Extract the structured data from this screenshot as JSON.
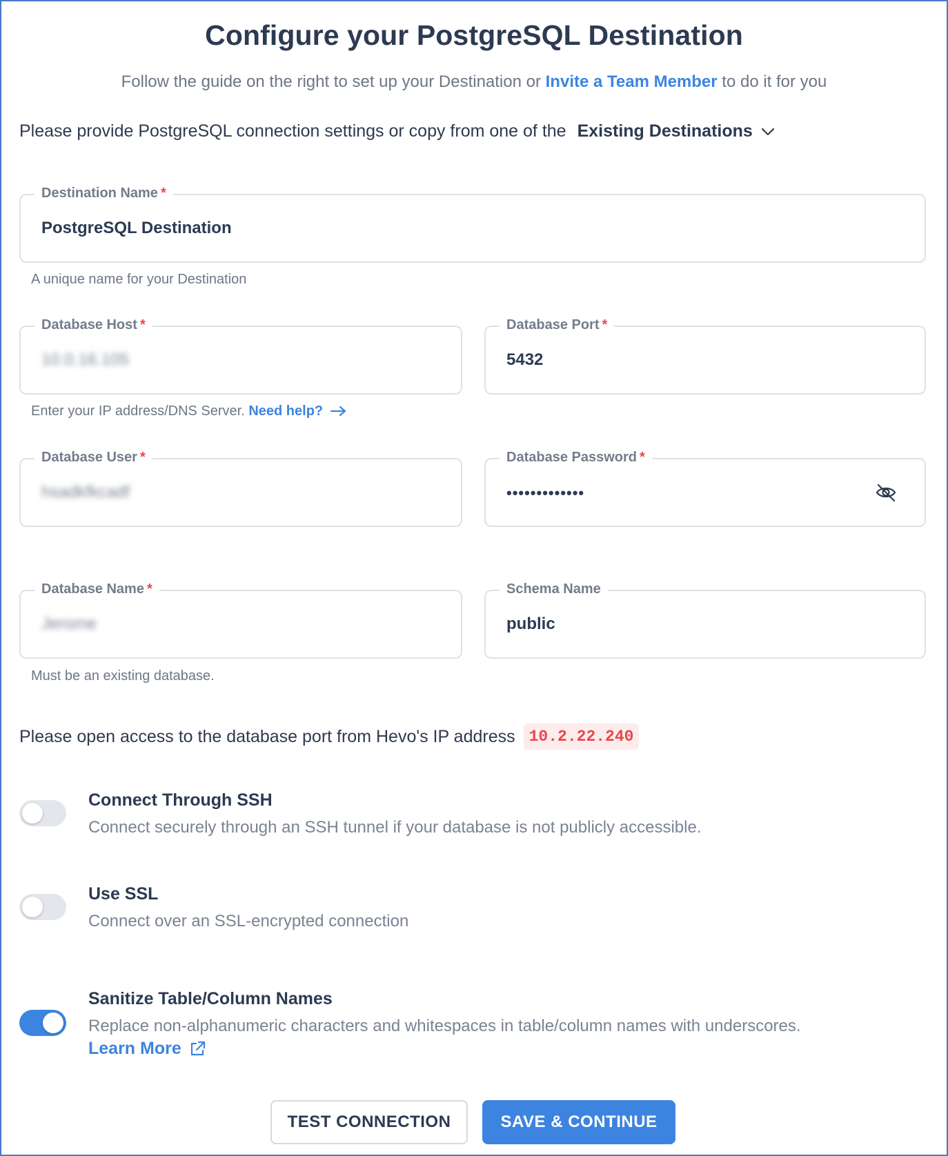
{
  "header": {
    "title": "Configure your PostgreSQL Destination",
    "subtitle_prefix": "Follow the guide on the right to set up your Destination or ",
    "subtitle_link": "Invite a Team Member",
    "subtitle_suffix": " to do it for you"
  },
  "provide": {
    "text": "Please provide PostgreSQL connection settings or copy from one of the",
    "dropdown_label": "Existing Destinations"
  },
  "fields": {
    "destination_name": {
      "label": "Destination Name",
      "required": "*",
      "value": "PostgreSQL Destination",
      "hint": "A unique name for your Destination"
    },
    "db_host": {
      "label": "Database Host",
      "required": "*",
      "value": "10.0.16.105",
      "hint": "Enter your IP address/DNS Server.",
      "hint_link": "Need help?"
    },
    "db_port": {
      "label": "Database Port",
      "required": "*",
      "value": "5432"
    },
    "db_user": {
      "label": "Database User",
      "required": "*",
      "value": "hsadkfkcadf"
    },
    "db_password": {
      "label": "Database Password",
      "required": "*",
      "value": "•••••••••••••"
    },
    "db_name": {
      "label": "Database Name",
      "required": "*",
      "value": "Jerome",
      "hint": "Must be an existing database."
    },
    "schema_name": {
      "label": "Schema Name",
      "value": "public"
    }
  },
  "ip_access": {
    "text": "Please open access to the database port from Hevo's IP address",
    "ip": "10.2.22.240"
  },
  "toggles": [
    {
      "title": "Connect Through SSH",
      "description": "Connect securely through an SSH tunnel if your database is not publicly accessible.",
      "on": false
    },
    {
      "title": "Use SSL",
      "description": "Connect over an SSL-encrypted connection",
      "on": false
    },
    {
      "title": "Sanitize Table/Column Names",
      "description": "Replace non-alphanumeric characters and whitespaces in table/column names with underscores.",
      "link": "Learn More",
      "on": true
    }
  ],
  "buttons": {
    "test": "TEST CONNECTION",
    "save": "SAVE & CONTINUE"
  },
  "colors": {
    "accent": "#3d84e0",
    "required": "#e5484d",
    "frame": "#4a78c9"
  },
  "icons": {
    "dropdown": "chevron-down-icon",
    "help_arrow": "arrow-right-icon",
    "password_toggle": "eye-off-icon",
    "learn_more": "external-link-icon"
  }
}
